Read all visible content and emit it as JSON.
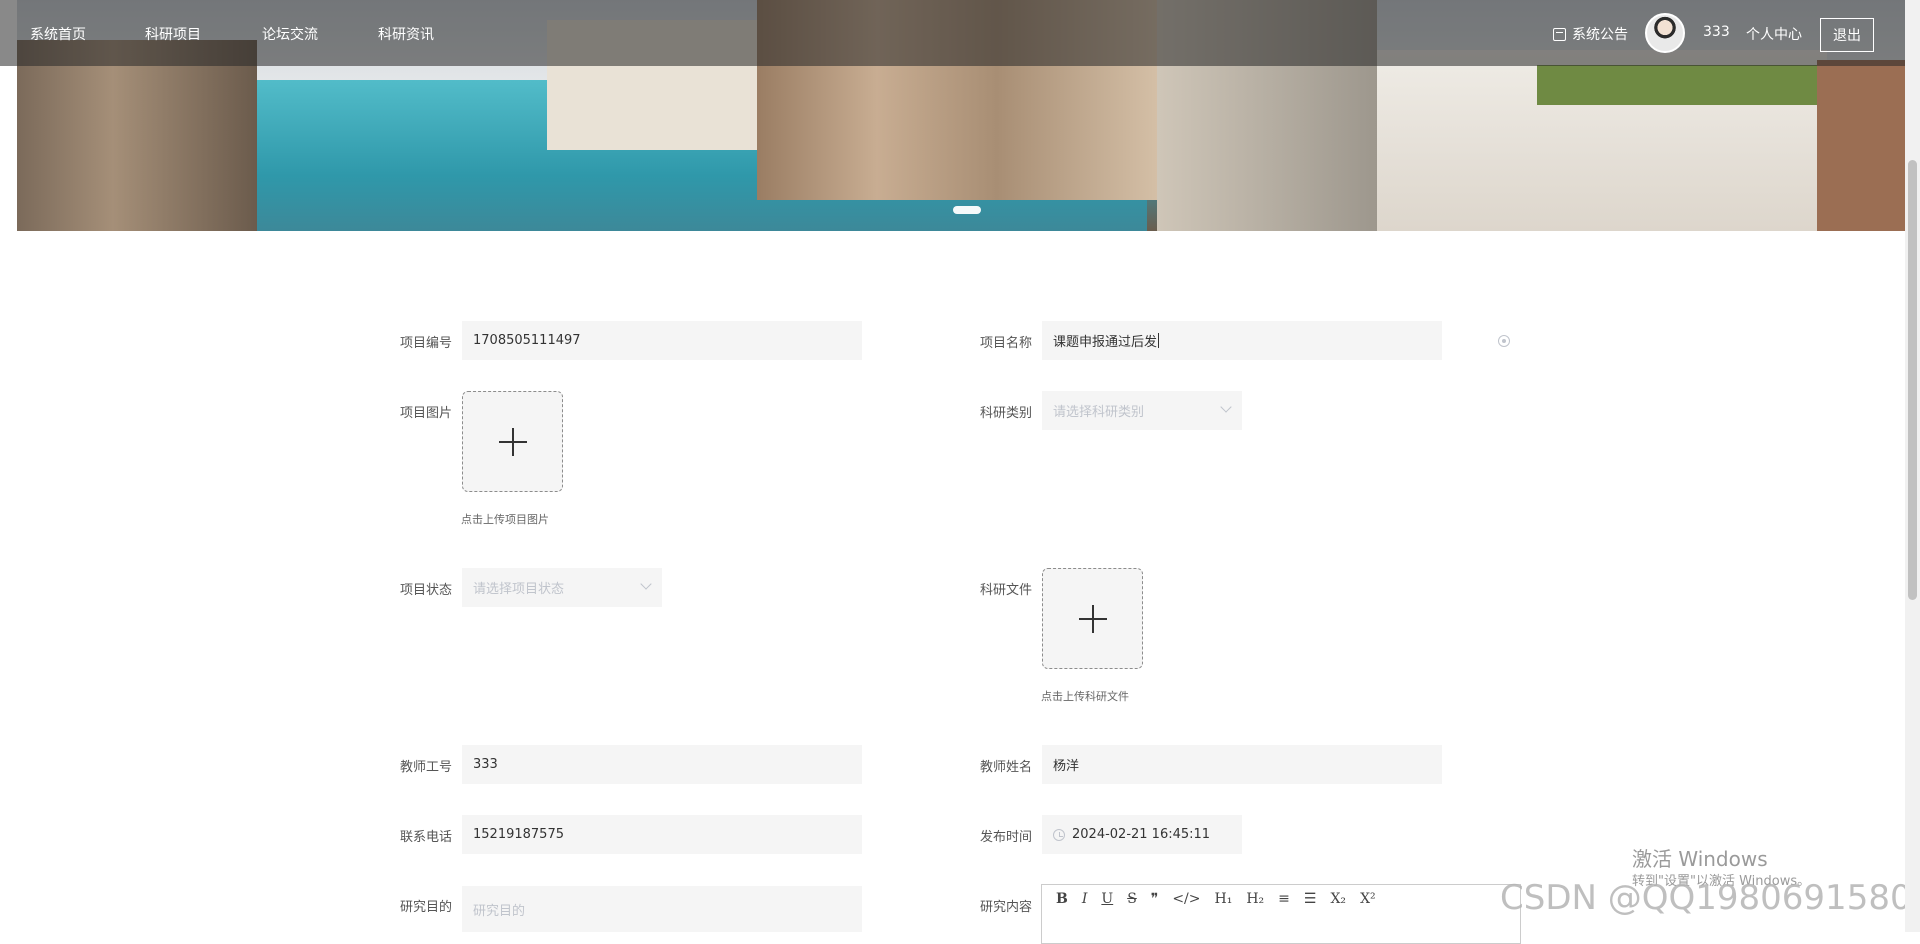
{
  "nav": {
    "items": [
      "系统首页",
      "科研项目",
      "论坛交流",
      "科研资讯"
    ],
    "notice_label": "系统公告",
    "username": "333",
    "personal_center": "个人中心",
    "logout": "退出"
  },
  "form": {
    "project_no": {
      "label": "项目编号",
      "value": "1708505111497"
    },
    "project_name": {
      "label": "项目名称",
      "value": "课题申报通过后发"
    },
    "project_image": {
      "label": "项目图片",
      "hint": "点击上传项目图片"
    },
    "research_category": {
      "label": "科研类别",
      "placeholder": "请选择科研类别"
    },
    "project_status": {
      "label": "项目状态",
      "placeholder": "请选择项目状态"
    },
    "research_file": {
      "label": "科研文件",
      "hint": "点击上传科研文件"
    },
    "teacher_id": {
      "label": "教师工号",
      "value": "333"
    },
    "teacher_name": {
      "label": "教师姓名",
      "value": "杨洋"
    },
    "phone": {
      "label": "联系电话",
      "value": "15219187575"
    },
    "publish_time": {
      "label": "发布时间",
      "value": "2024-02-21 16:45:11"
    },
    "research_purpose": {
      "label": "研究目的",
      "placeholder": "研究目的"
    },
    "research_content": {
      "label": "研究内容"
    }
  },
  "editor_toolbar": [
    "B",
    "I",
    "U",
    "S",
    "❞",
    "</>",
    "H₁",
    "H₂",
    "≡",
    "☰",
    "X₂",
    "X²"
  ],
  "watermarks": {
    "windows_title": "激活 Windows",
    "windows_sub": "转到\"设置\"以激活 Windows。",
    "csdn": "CSDN @QQ1980691580"
  },
  "colors": {
    "nav_bg": "#282828",
    "input_bg": "#f5f5f5",
    "placeholder": "#c0c4cc"
  }
}
